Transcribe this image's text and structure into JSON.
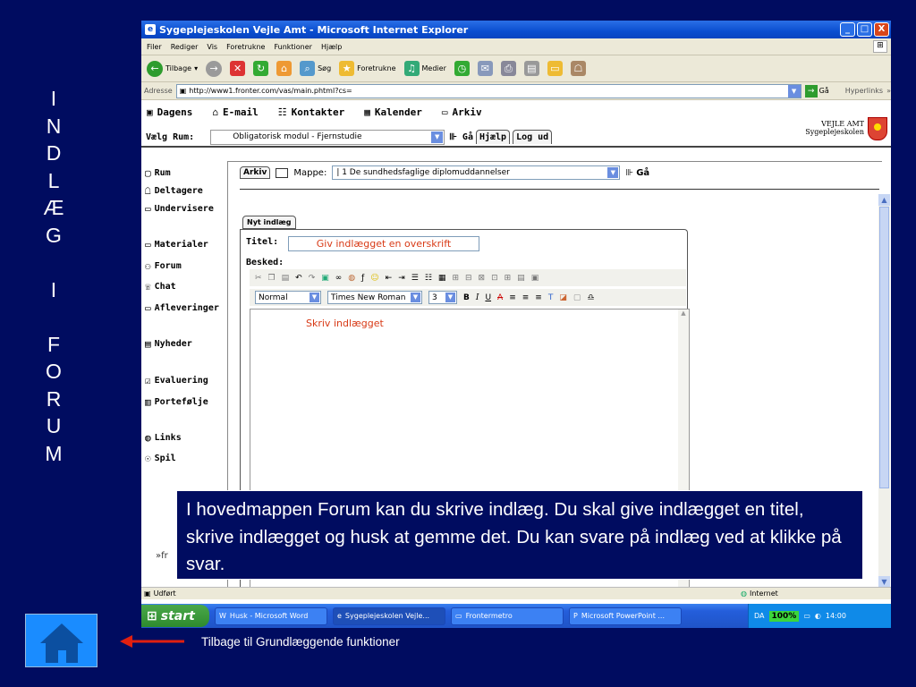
{
  "side_title_letters": [
    "I",
    "N",
    "D",
    "L",
    "Æ",
    "G",
    "",
    "I",
    "",
    "F",
    "O",
    "R",
    "U",
    "M"
  ],
  "window": {
    "title": "Sygeplejeskolen Vejle Amt - Microsoft Internet Explorer",
    "min": "_",
    "max": "□",
    "close": "X"
  },
  "menubar": [
    "Filer",
    "Rediger",
    "Vis",
    "Foretrukne",
    "Funktioner",
    "Hjælp"
  ],
  "toolbar": {
    "back": "Tilbage",
    "search": "Søg",
    "favorites": "Foretrukne",
    "media": "Medier"
  },
  "address": {
    "label": "Adresse",
    "url": "http://www1.fronter.com/vas/main.phtml?cs=",
    "go": "Gå",
    "links": "Hyperlinks"
  },
  "nav_top": [
    "Dagens",
    "E-mail",
    "Kontakter",
    "Kalender",
    "Arkiv"
  ],
  "rum": {
    "label": "Vælg Rum:",
    "selected": "Obligatorisk modul - Fjernstudie",
    "go": "Gå",
    "help": "Hjælp",
    "logout": "Log ud"
  },
  "logo": {
    "line1": "VEJLE AMT",
    "line2": "Sygeplejeskolen"
  },
  "left_nav": [
    "Rum",
    "Deltagere",
    "Undervisere",
    "Materialer",
    "Forum",
    "Chat",
    "Afleveringer",
    "Nyheder",
    "Evaluering",
    "Portefølje",
    "Links",
    "Spil"
  ],
  "front_link": "fr",
  "arkiv": {
    "tab": "Arkiv",
    "mappe_label": "Mappe:",
    "mappe_value": "| 1 De sundhedsfaglige diplomuddannelser",
    "go": "Gå"
  },
  "editor": {
    "new_post_tab": "Nyt indlæg",
    "title_label": "Titel:",
    "title_value": "Giv indlægget en overskrift",
    "message_label": "Besked:",
    "style": "Normal",
    "font": "Times New Roman",
    "size": "3",
    "body_text": "Skriv indlægget"
  },
  "statusbar": {
    "left": "Udført",
    "zone": "Internet"
  },
  "taskbar": {
    "start": "start",
    "tasks": [
      "Husk - Microsoft Word",
      "Sygeplejeskolen Vejle...",
      "Frontermetro",
      "Microsoft PowerPoint ..."
    ],
    "lang": "DA",
    "battery": "100%",
    "clock": "14:00"
  },
  "overlay_text": "I hovedmappen Forum kan du skrive indlæg. Du skal  give indlægget en titel, skrive indlægget og husk at gemme det. Du kan svare på indlæg ved at klikke på svar.",
  "back_label": "Tilbage til Grundlæggende funktioner"
}
